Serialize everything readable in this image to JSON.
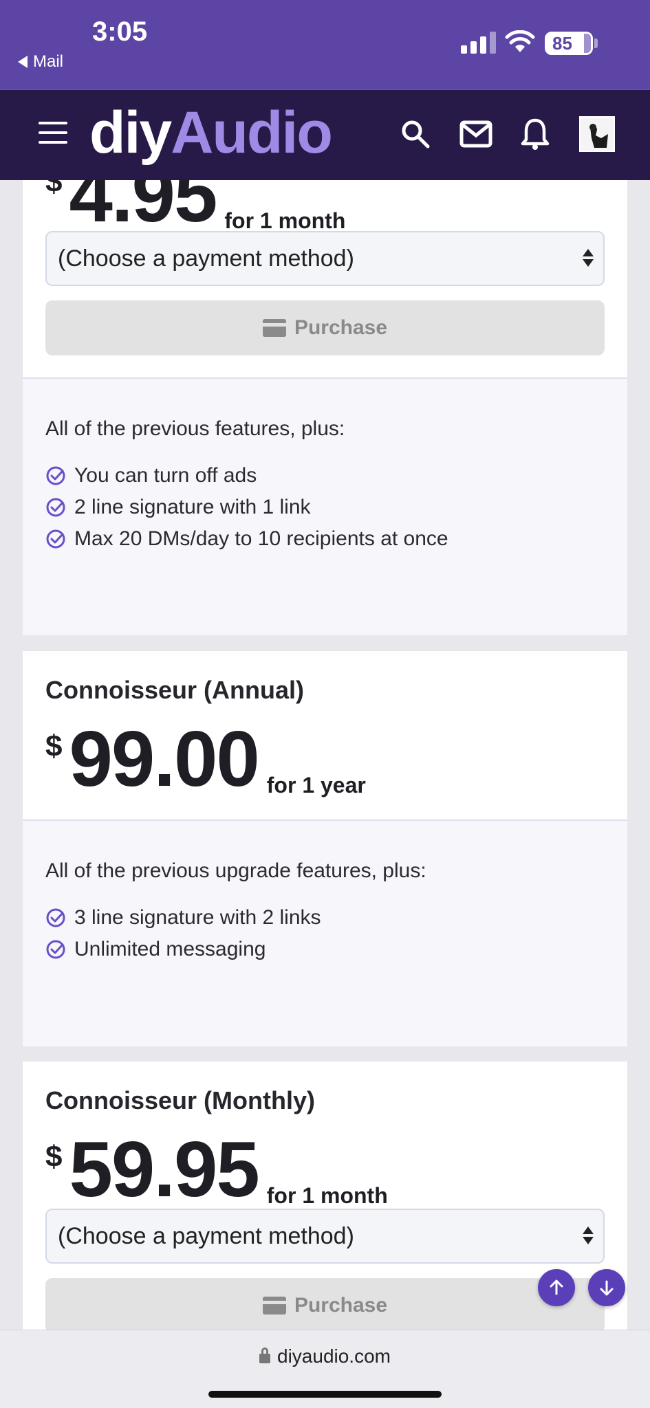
{
  "status_bar": {
    "time": "3:05",
    "back_app": "Mail",
    "battery": "85"
  },
  "navbar": {
    "logo_part1": "diy",
    "logo_part2": "Audio"
  },
  "plans": [
    {
      "title": "",
      "currency": "$",
      "price": "4.95",
      "period": "for 1 month",
      "select_value": "(Choose a payment method)",
      "purchase_label": "Purchase",
      "features_intro": "All of the previous features, plus:",
      "features": [
        "You can turn off ads",
        "2 line signature with 1 link",
        "Max 20 DMs/day to 10 recipients at once"
      ]
    },
    {
      "title": "Connoisseur (Annual)",
      "currency": "$",
      "price": "99.00",
      "period": "for 1 year",
      "features_intro": "All of the previous upgrade features, plus:",
      "features": [
        "3 line signature with 2 links",
        "Unlimited messaging"
      ]
    },
    {
      "title": "Connoisseur (Monthly)",
      "currency": "$",
      "price": "59.95",
      "period": "for 1 month",
      "select_value": "(Choose a payment method)",
      "purchase_label": "Purchase"
    }
  ],
  "browser": {
    "url": "diyaudio.com"
  },
  "colors": {
    "status_bar": "#5d45a6",
    "navbar": "#271a48",
    "logo_accent": "#a08ae6",
    "check": "#6a4fc8",
    "fab": "#5a3fb8"
  }
}
